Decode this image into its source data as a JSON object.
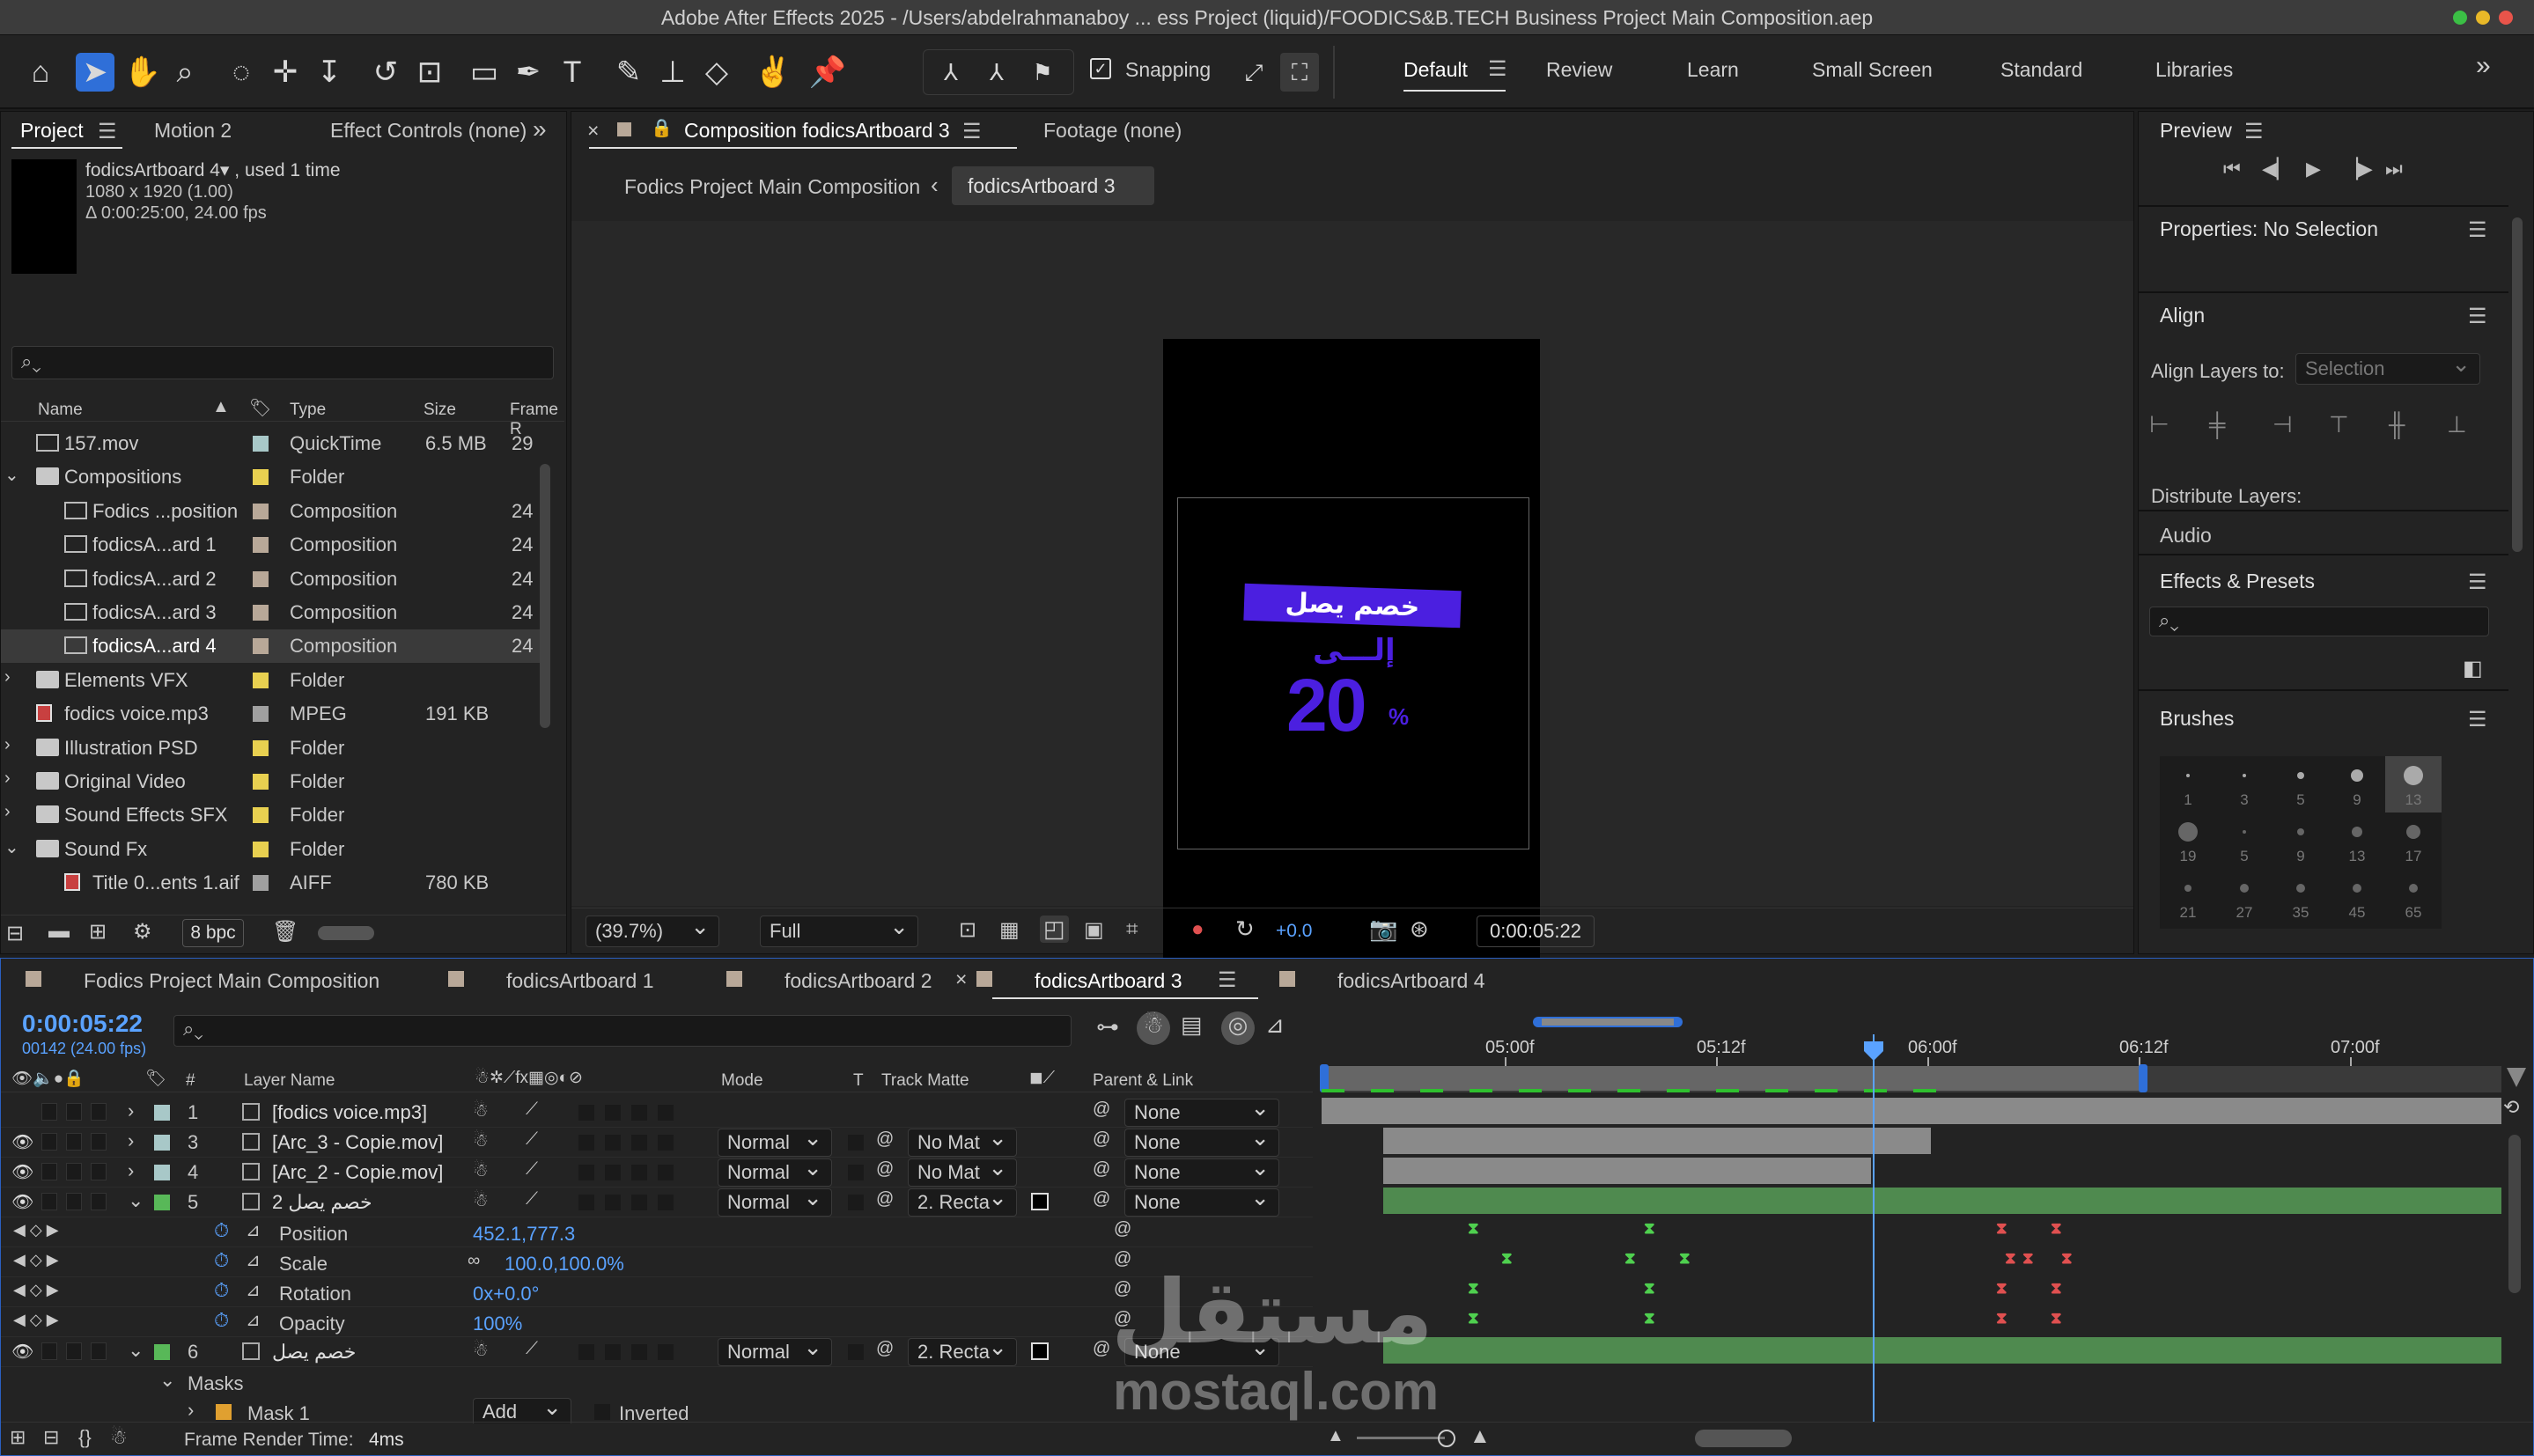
{
  "window": {
    "title": "Adobe After Effects 2025 - /Users/abdelrahmanaboy ... ess Project (liquid)/FOODICS&B.TECH Business Project Main Composition.aep"
  },
  "toolbar": {
    "snapping_label": "Snapping",
    "workspaces": [
      "Default",
      "Review",
      "Learn",
      "Small Screen",
      "Standard",
      "Libraries"
    ],
    "more": "»"
  },
  "project": {
    "tabs": [
      "Project",
      "Motion 2",
      "Effect Controls (none)"
    ],
    "selected_name": "fodicsArtboard 4▾ , used 1 time",
    "selected_dims": "1080 x 1920 (1.00)",
    "selected_dur": "Δ 0:00:25:00, 24.00 fps",
    "search_placeholder": "",
    "columns": [
      "Name",
      "Type",
      "Size",
      "Frame R"
    ],
    "items": [
      {
        "name": "157.mov",
        "type": "QuickTime",
        "size": "6.5 MB",
        "fr": "29",
        "color": "#a8c8c8",
        "indent": 0,
        "kind": "file"
      },
      {
        "name": "Compositions",
        "type": "Folder",
        "size": "",
        "fr": "",
        "color": "#e8d050",
        "indent": 0,
        "kind": "folder-open"
      },
      {
        "name": "Fodics ...position",
        "type": "Composition",
        "size": "",
        "fr": "24",
        "color": "#b8a898",
        "indent": 1,
        "kind": "comp"
      },
      {
        "name": "fodicsA...ard 1",
        "type": "Composition",
        "size": "",
        "fr": "24",
        "color": "#b8a898",
        "indent": 1,
        "kind": "comp"
      },
      {
        "name": "fodicsA...ard 2",
        "type": "Composition",
        "size": "",
        "fr": "24",
        "color": "#b8a898",
        "indent": 1,
        "kind": "comp"
      },
      {
        "name": "fodicsA...ard 3",
        "type": "Composition",
        "size": "",
        "fr": "24",
        "color": "#b8a898",
        "indent": 1,
        "kind": "comp"
      },
      {
        "name": "fodicsA...ard 4",
        "type": "Composition",
        "size": "",
        "fr": "24",
        "color": "#b8a898",
        "indent": 1,
        "kind": "comp",
        "selected": true
      },
      {
        "name": "Elements VFX",
        "type": "Folder",
        "size": "",
        "fr": "",
        "color": "#e8d050",
        "indent": 0,
        "kind": "folder"
      },
      {
        "name": "fodics voice.mp3",
        "type": "MPEG",
        "size": "191 KB",
        "fr": "",
        "color": "#a0a0a0",
        "indent": 0,
        "kind": "audio"
      },
      {
        "name": "Illustration PSD",
        "type": "Folder",
        "size": "",
        "fr": "",
        "color": "#e8d050",
        "indent": 0,
        "kind": "folder"
      },
      {
        "name": "Original Video",
        "type": "Folder",
        "size": "",
        "fr": "",
        "color": "#e8d050",
        "indent": 0,
        "kind": "folder"
      },
      {
        "name": "Sound Effects SFX",
        "type": "Folder",
        "size": "",
        "fr": "",
        "color": "#e8d050",
        "indent": 0,
        "kind": "folder"
      },
      {
        "name": "Sound Fx",
        "type": "Folder",
        "size": "",
        "fr": "",
        "color": "#e8d050",
        "indent": 0,
        "kind": "folder-open"
      },
      {
        "name": "Title 0...ents 1.aif",
        "type": "AIFF",
        "size": "780 KB",
        "fr": "",
        "color": "#a0a0a0",
        "indent": 1,
        "kind": "audio"
      }
    ],
    "bpc": "8 bpc"
  },
  "comp": {
    "tab_close": "×",
    "tab_label": "Composition fodicsArtboard 3",
    "footage_label": "Footage (none)",
    "breadcrumb": [
      "Fodics Project Main Composition",
      "fodicsArtboard 3"
    ],
    "art": {
      "banner": "خصم يصل",
      "line2": "إلـــى",
      "number": "20",
      "percent": "%"
    },
    "zoom": "(39.7%)",
    "quality": "Full",
    "exposure": "+0.0",
    "timecode": "0:00:05:22"
  },
  "right": {
    "preview": "Preview",
    "properties": "Properties: No Selection",
    "align": "Align",
    "align_to_label": "Align Layers to:",
    "align_to_value": "Selection",
    "distribute": "Distribute Layers:",
    "audio": "Audio",
    "effects": "Effects & Presets",
    "brushes": "Brushes",
    "brush_sizes": [
      "1",
      "3",
      "5",
      "9",
      "13",
      "19",
      "5",
      "9",
      "13",
      "17",
      "21",
      "27",
      "35",
      "45",
      "65"
    ]
  },
  "timeline": {
    "tabs": [
      "Fodics Project Main Composition",
      "fodicsArtboard 1",
      "fodicsArtboard 2",
      "fodicsArtboard 3",
      "fodicsArtboard 4"
    ],
    "active_tab": "fodicsArtboard 3",
    "timecode": "0:00:05:22",
    "frames": "00142 (24.00 fps)",
    "col_layer": "Layer Name",
    "col_mode": "Mode",
    "col_t": "T",
    "col_track": "Track Matte",
    "col_parent": "Parent & Link",
    "col_num": "#",
    "ruler": [
      "05:00f",
      "05:12f",
      "06:00f",
      "06:12f",
      "07:00f"
    ],
    "layers": [
      {
        "num": "1",
        "name": "[fodics voice.mp3]",
        "color": "#a8c8c8",
        "mode": "",
        "matte": "",
        "parent": "None",
        "eye": false
      },
      {
        "num": "3",
        "name": "[Arc_3 - Copie.mov]",
        "color": "#a8c8c8",
        "mode": "Normal",
        "matte": "No Mat",
        "parent": "None",
        "eye": true
      },
      {
        "num": "4",
        "name": "[Arc_2 - Copie.mov]",
        "color": "#a8c8c8",
        "mode": "Normal",
        "matte": "No Mat",
        "parent": "None",
        "eye": true
      },
      {
        "num": "5",
        "name": "خصم يصل 2",
        "color": "#58b858",
        "mode": "Normal",
        "matte": "2. Recta",
        "parent": "None",
        "eye": true,
        "open": true
      }
    ],
    "props": [
      {
        "name": "Position",
        "value": "452.1,777.3"
      },
      {
        "name": "Scale",
        "value": "100.0,100.0%"
      },
      {
        "name": "Rotation",
        "value": "0x+0.0°"
      },
      {
        "name": "Opacity",
        "value": "100%"
      }
    ],
    "layer6": {
      "num": "6",
      "name": "خصم يصل",
      "mode": "Normal",
      "matte": "2. Recta",
      "parent": "None"
    },
    "masks": "Masks",
    "mask1": "Mask 1",
    "mask_mode": "Add",
    "inverted": "Inverted",
    "render_label": "Frame Render Time:",
    "render_value": "4ms"
  },
  "watermark": {
    "arabic": "مستقل",
    "latin": "mostaql.com"
  }
}
